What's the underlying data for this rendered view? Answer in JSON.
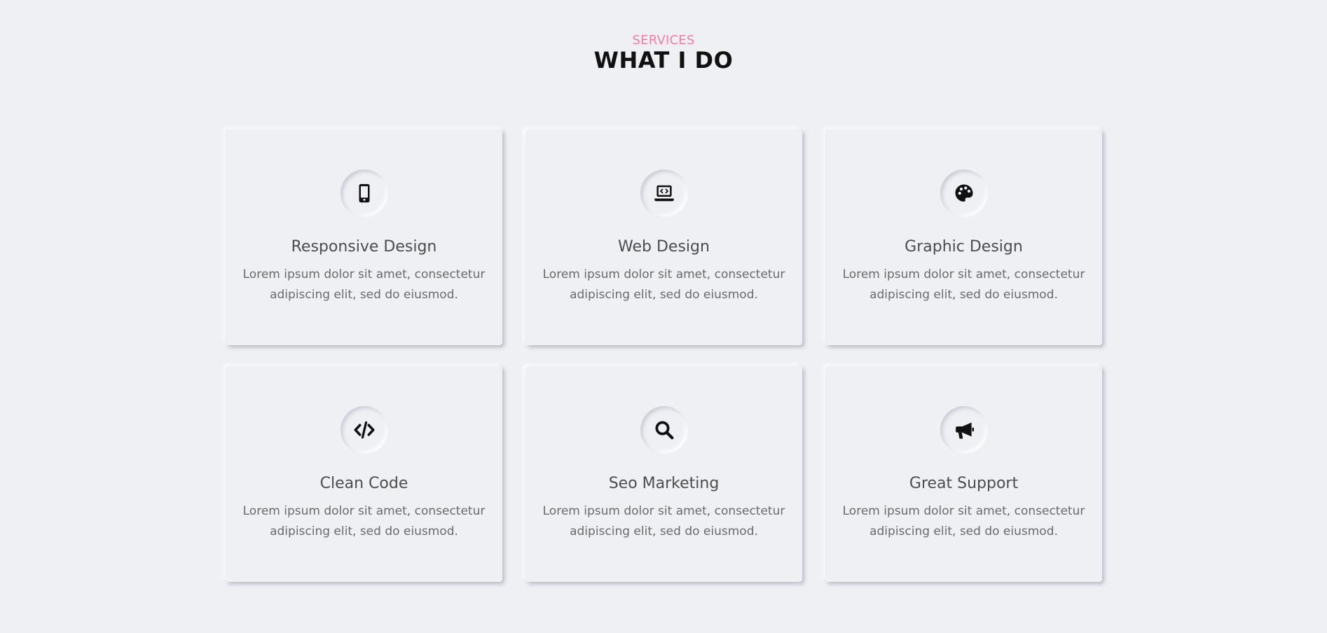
{
  "header": {
    "eyebrow": "SERVICES",
    "title": "WHAT I DO"
  },
  "colors": {
    "background": "#eff0f4",
    "accent": "#f07ea4",
    "title": "#111111",
    "card_title": "#4c4c4c",
    "card_text": "#6a6a6a"
  },
  "services": [
    {
      "icon": "mobile-icon",
      "title": "Responsive Design",
      "text": "Lorem ipsum dolor sit amet, consectetur adipiscing elit, sed do eiusmod."
    },
    {
      "icon": "laptop-code-icon",
      "title": "Web Design",
      "text": "Lorem ipsum dolor sit amet, consectetur adipiscing elit, sed do eiusmod."
    },
    {
      "icon": "palette-icon",
      "title": "Graphic Design",
      "text": "Lorem ipsum dolor sit amet, consectetur adipiscing elit, sed do eiusmod."
    },
    {
      "icon": "code-icon",
      "title": "Clean Code",
      "text": "Lorem ipsum dolor sit amet, consectetur adipiscing elit, sed do eiusmod."
    },
    {
      "icon": "search-icon",
      "title": "Seo Marketing",
      "text": "Lorem ipsum dolor sit amet, consectetur adipiscing elit, sed do eiusmod."
    },
    {
      "icon": "megaphone-icon",
      "title": "Great Support",
      "text": "Lorem ipsum dolor sit amet, consectetur adipiscing elit, sed do eiusmod."
    }
  ]
}
